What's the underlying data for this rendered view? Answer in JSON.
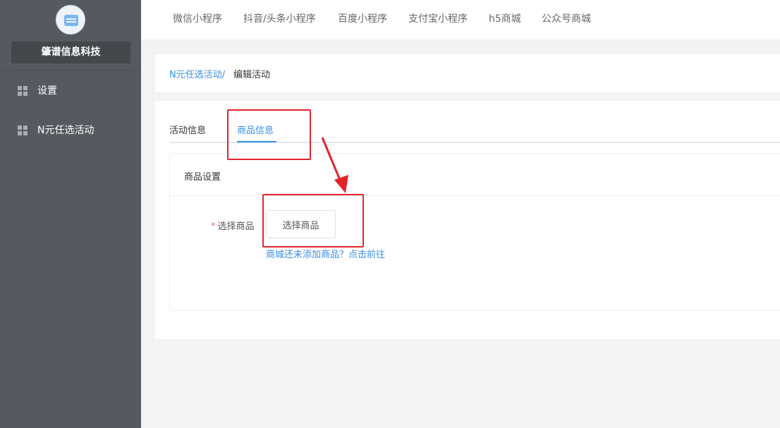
{
  "sidebar": {
    "logo_icon": "shop-logo-icon",
    "brand": "肇谱信息科技",
    "items": [
      {
        "label": "设置",
        "icon": "grid-icon"
      },
      {
        "label": "N元任选活动",
        "icon": "grid-icon"
      }
    ]
  },
  "topnav": {
    "tabs": [
      "微信小程序",
      "抖音/头条小程序",
      "百度小程序",
      "支付宝小程序",
      "h5商城",
      "公众号商城"
    ]
  },
  "breadcrumb": {
    "parent": "N元任选活动/",
    "current": "编辑活动"
  },
  "main": {
    "tabs": [
      "活动信息",
      "商品信息"
    ],
    "active_tab": 1,
    "panel": {
      "title": "商品设置",
      "required_mark": "*",
      "field_label": "选择商品",
      "button_label": "选择商品",
      "hint_link": "商城还未添加商品？点击前往"
    }
  },
  "colors": {
    "sidebar_bg": "#545a60",
    "accent": "#3a8ee6",
    "annotation": "#e3242b",
    "required": "#f56c6c"
  }
}
